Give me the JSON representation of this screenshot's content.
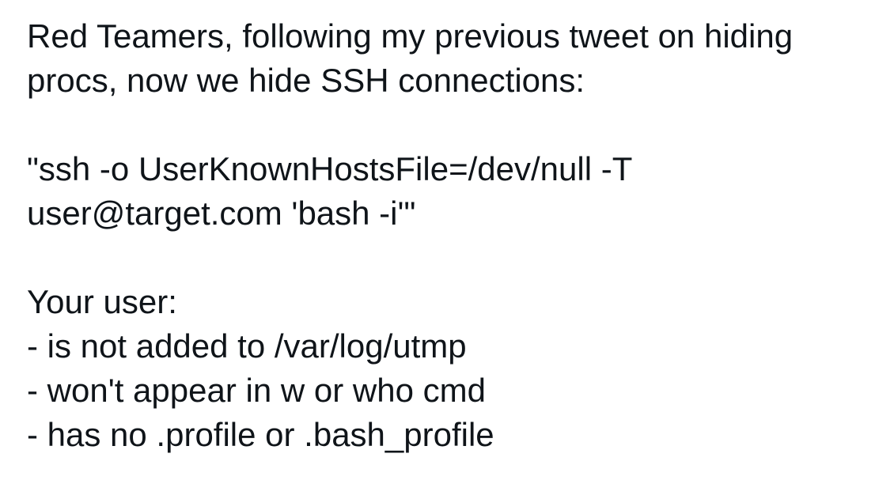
{
  "tweet": {
    "intro_line_1": "Red Teamers, following my previous tweet on hiding",
    "intro_line_2": "procs, now we hide SSH connections:",
    "command_line_1": "\"ssh -o UserKnownHostsFile=/dev/null -T",
    "command_line_2": "user@target.com 'bash -i'\"",
    "your_user_heading": "Your user:",
    "bullets": [
      "- is not added to /var/log/utmp",
      "- won't appear in w or who cmd",
      "- has no .profile or .bash_profile"
    ]
  },
  "colors": {
    "background": "#ffffff",
    "text": "#0f1419"
  }
}
